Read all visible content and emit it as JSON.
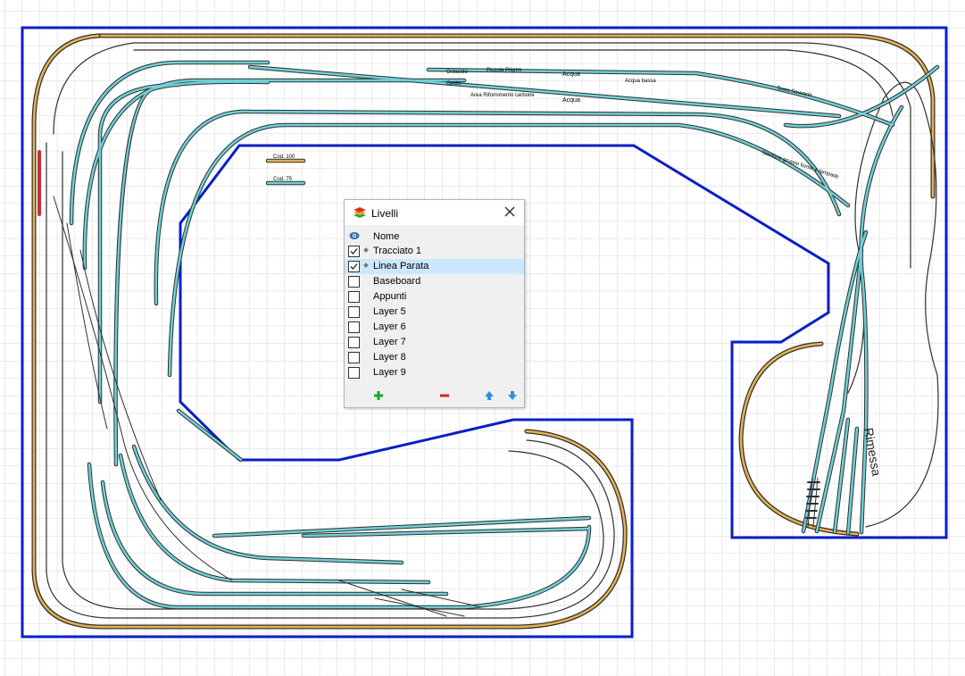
{
  "layout_labels": {
    "cod100": "Cod. 100",
    "cod75": "Cod. 75",
    "track_small": [
      "Ostacolo",
      "Piccola Pilgrim",
      "Acqua",
      "Acqua",
      "Acqua bassa",
      "Gesto",
      "Area Rifornimento carbone",
      "Tomo Souvenir",
      "Stazione gruppo forme e lampade"
    ],
    "rimessa": "Rimessa"
  },
  "layers_panel": {
    "title": "Livelli",
    "column_header": "Nome",
    "layers": [
      {
        "name": "Tracciato 1",
        "checked": true,
        "active": true,
        "selected": false
      },
      {
        "name": "Linea Parata",
        "checked": true,
        "active": true,
        "selected": true
      },
      {
        "name": "Baseboard",
        "checked": false,
        "active": false,
        "selected": false
      },
      {
        "name": "Appunti",
        "checked": false,
        "active": false,
        "selected": false
      },
      {
        "name": "Layer 5",
        "checked": false,
        "active": false,
        "selected": false
      },
      {
        "name": "Layer 6",
        "checked": false,
        "active": false,
        "selected": false
      },
      {
        "name": "Layer 7",
        "checked": false,
        "active": false,
        "selected": false
      },
      {
        "name": "Layer 8",
        "checked": false,
        "active": false,
        "selected": false
      },
      {
        "name": "Layer 9",
        "checked": false,
        "active": false,
        "selected": false
      }
    ],
    "buttons": {
      "add": "add-icon",
      "remove": "remove-icon",
      "move_up": "arrow-up-icon",
      "move_down": "arrow-down-icon"
    }
  },
  "colors": {
    "grid": "#d6d6d6",
    "baseboard": "#0a1ec8",
    "track_cyan": "#6ed0d8",
    "track_orange": "#e7b34f",
    "track_outline": "#303030",
    "selected_row": "#cce8ff",
    "add_green": "#1fa82a",
    "remove_red": "#d42020",
    "arrow_blue": "#2e8fe0"
  }
}
